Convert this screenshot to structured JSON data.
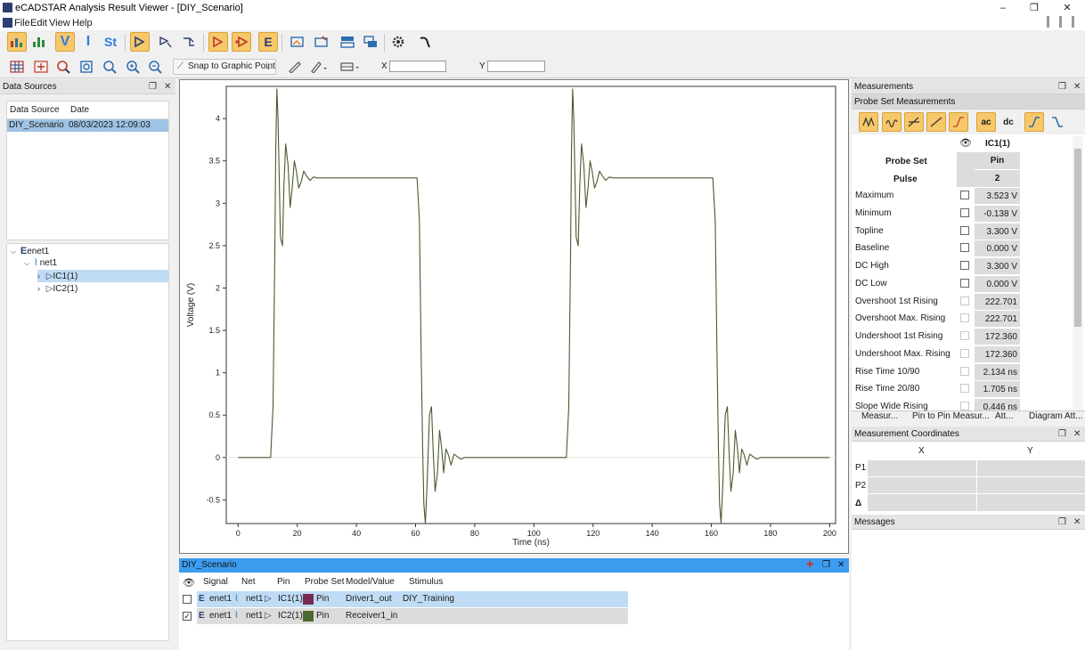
{
  "window": {
    "title": "eCADSTAR Analysis Result Viewer - [DIY_Scenario]",
    "min": "–",
    "restore": "❐",
    "close": "✕"
  },
  "menu": {
    "file": "File",
    "edit": "Edit",
    "view": "View",
    "help": "Help"
  },
  "toolbar": {
    "text_v": "V",
    "text_i": "I",
    "text_st": "St",
    "snap_label": "Snap to Graphic Point",
    "x_label": "X",
    "y_label": "Y",
    "x_value": "",
    "y_value": ""
  },
  "data_sources": {
    "title": "Data Sources",
    "columns": [
      "Data Source",
      "Date"
    ],
    "rows": [
      {
        "source": "DIY_Scenario",
        "date": "08/03/2023 12:09:03"
      }
    ],
    "tree": {
      "enet": "enet1",
      "net": "net1",
      "ic1": "IC1(1)",
      "ic2": "IC2(1)"
    }
  },
  "chart_data": {
    "type": "line",
    "title": "",
    "xlabel": "Time (ns)",
    "ylabel": "Voltage (V)",
    "xlim": [
      -4,
      202
    ],
    "ylim": [
      -0.78,
      4.38
    ],
    "xticks": [
      0,
      20,
      40,
      60,
      80,
      100,
      120,
      140,
      160,
      180,
      200
    ],
    "yticks": [
      -0.5,
      0,
      0.5,
      1,
      1.5,
      2,
      2.5,
      3,
      3.5,
      4
    ],
    "grid": false,
    "zero_line": true,
    "series": [
      {
        "color": "#4a5a2e",
        "x": [
          0,
          11.0,
          11.8,
          12.4,
          12.7,
          13.1,
          13.5,
          14.3,
          15.0,
          15.5,
          16.1,
          16.9,
          17.6,
          18.3,
          19.0,
          19.7,
          20.5,
          21.3,
          22.2,
          23.2,
          24.3,
          25.5,
          26.8,
          30,
          35,
          60.5,
          61.3,
          61.9,
          62.4,
          62.8,
          63.3,
          63.9,
          64.7,
          65.4,
          66.0,
          66.6,
          67.4,
          68.1,
          68.8,
          69.5,
          70.3,
          71.1,
          72.0,
          73.0,
          74.1,
          75.3,
          76.6,
          80,
          90,
          111.0,
          111.8,
          112.4,
          112.7,
          113.1,
          113.5,
          114.3,
          115.0,
          115.5,
          116.1,
          116.9,
          117.6,
          118.3,
          119.0,
          119.7,
          120.5,
          121.3,
          122.2,
          123.2,
          124.3,
          125.5,
          126.8,
          130,
          135,
          160.5,
          161.3,
          161.9,
          162.4,
          162.8,
          163.3,
          163.9,
          164.7,
          165.4,
          166.0,
          166.6,
          167.4,
          168.1,
          168.8,
          169.5,
          170.3,
          171.1,
          172.0,
          173.0,
          174.1,
          175.3,
          176.6,
          180,
          200
        ],
        "y": [
          0,
          0,
          0.6,
          2.4,
          3.6,
          4.35,
          4.0,
          2.6,
          2.5,
          3.2,
          3.7,
          3.45,
          2.95,
          3.18,
          3.5,
          3.38,
          3.18,
          3.25,
          3.38,
          3.32,
          3.27,
          3.31,
          3.3,
          3.3,
          3.3,
          3.3,
          2.8,
          1.2,
          0.1,
          -0.55,
          -0.78,
          -0.3,
          0.5,
          0.6,
          0.05,
          -0.4,
          -0.18,
          0.32,
          0.12,
          -0.18,
          0.1,
          0.03,
          -0.09,
          0.04,
          0.01,
          -0.02,
          0.0,
          0.0,
          0.0,
          0,
          0.6,
          2.4,
          3.6,
          4.35,
          4.0,
          2.6,
          2.5,
          3.2,
          3.7,
          3.45,
          2.95,
          3.18,
          3.5,
          3.38,
          3.18,
          3.25,
          3.38,
          3.32,
          3.27,
          3.31,
          3.3,
          3.3,
          3.3,
          3.3,
          2.8,
          1.2,
          0.1,
          -0.55,
          -0.78,
          -0.3,
          0.5,
          0.6,
          0.05,
          -0.4,
          -0.18,
          0.32,
          0.12,
          -0.18,
          0.1,
          0.03,
          -0.09,
          0.04,
          0.01,
          -0.02,
          0.0,
          0.0,
          0.0
        ]
      }
    ]
  },
  "signals": {
    "title": "DIY_Scenario",
    "columns": [
      "Signal",
      "Net",
      "Pin",
      "Probe Set",
      "Model/Value",
      "Stimulus"
    ],
    "rows": [
      {
        "checked": false,
        "signal": "enet1",
        "net": "net1",
        "pin": "IC1(1)",
        "probe_set": "Pin",
        "model": "Driver1_out",
        "stimulus": "DIY_Training",
        "color": "#7a2a50"
      },
      {
        "checked": true,
        "signal": "enet1",
        "net": "net1",
        "pin": "IC2(1)",
        "probe_set": "Pin",
        "model": "Receiver1_in",
        "stimulus": "",
        "color": "#4f6a2e"
      }
    ]
  },
  "measurements": {
    "title": "Measurements",
    "subtitle": "Probe Set Measurements",
    "ac_label": "ac",
    "dc_label": "dc",
    "column": "IC1(1)",
    "probe_set_label": "Probe Set",
    "probe_set_value": "Pin",
    "pulse_label": "Pulse",
    "pulse_value": "2",
    "rows": [
      {
        "name": "Maximum",
        "value": "3.523 V"
      },
      {
        "name": "Minimum",
        "value": "-0.138 V"
      },
      {
        "name": "Topline",
        "value": "3.300 V"
      },
      {
        "name": "Baseline",
        "value": "0.000 V"
      },
      {
        "name": "DC High",
        "value": "3.300 V"
      },
      {
        "name": "DC Low",
        "value": "0.000 V"
      },
      {
        "name": "Overshoot 1st Rising",
        "value": "222.701 mV"
      },
      {
        "name": "Overshoot Max. Rising",
        "value": "222.701 mV"
      },
      {
        "name": "Undershoot 1st Rising",
        "value": "172.360 mV"
      },
      {
        "name": "Undershoot Max. Rising",
        "value": "172.360 mV"
      },
      {
        "name": "Rise Time 10/90",
        "value": "2.134 ns"
      },
      {
        "name": "Rise Time 20/80",
        "value": "1.705 ns"
      },
      {
        "name": "Slope Wide Rising",
        "value": "0.446 ns"
      }
    ],
    "tabs": [
      "Measur...",
      "Pin to Pin Measur...",
      "Att...",
      "Diagram Att..."
    ]
  },
  "coords": {
    "title": "Measurement Coordinates",
    "col_x": "X",
    "col_y": "Y",
    "p1": "P1",
    "p2": "P2",
    "delta": "Δ"
  },
  "messages": {
    "title": "Messages"
  }
}
